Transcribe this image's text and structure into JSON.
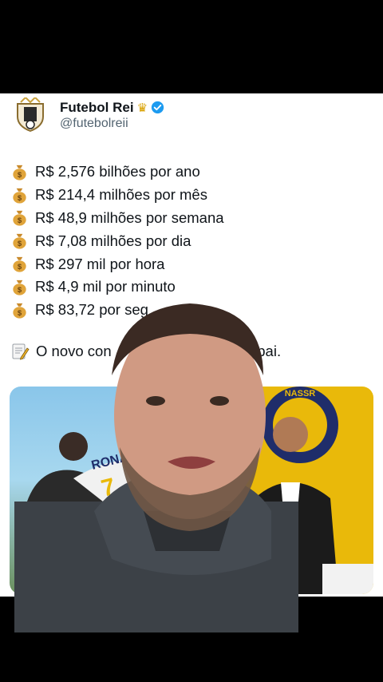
{
  "account": {
    "name": "Futebol Rei",
    "handle": "@futebolreii",
    "crown_icon": "crown-icon",
    "verified_icon": "verified-badge-icon"
  },
  "salary_lines": [
    "R$ 2,576 bilhões por ano",
    "R$ 214,4 milhões por mês",
    "R$ 48,9 milhões por semana",
    "R$ 7,08 milhões por dia",
    "R$ 297 mil por hora",
    "R$ 4,9 mil por minuto",
    "R$ 83,72 por seg"
  ],
  "note": {
    "start": "O novo con",
    "end": "Papai."
  },
  "media": {
    "badge_text": "NASSR",
    "jersey_text": "RONA",
    "jersey_number": "7"
  },
  "colors": {
    "brand_blue": "#1d9bf0",
    "club_yellow": "#e9b90a",
    "club_navy": "#1f2d6a"
  }
}
